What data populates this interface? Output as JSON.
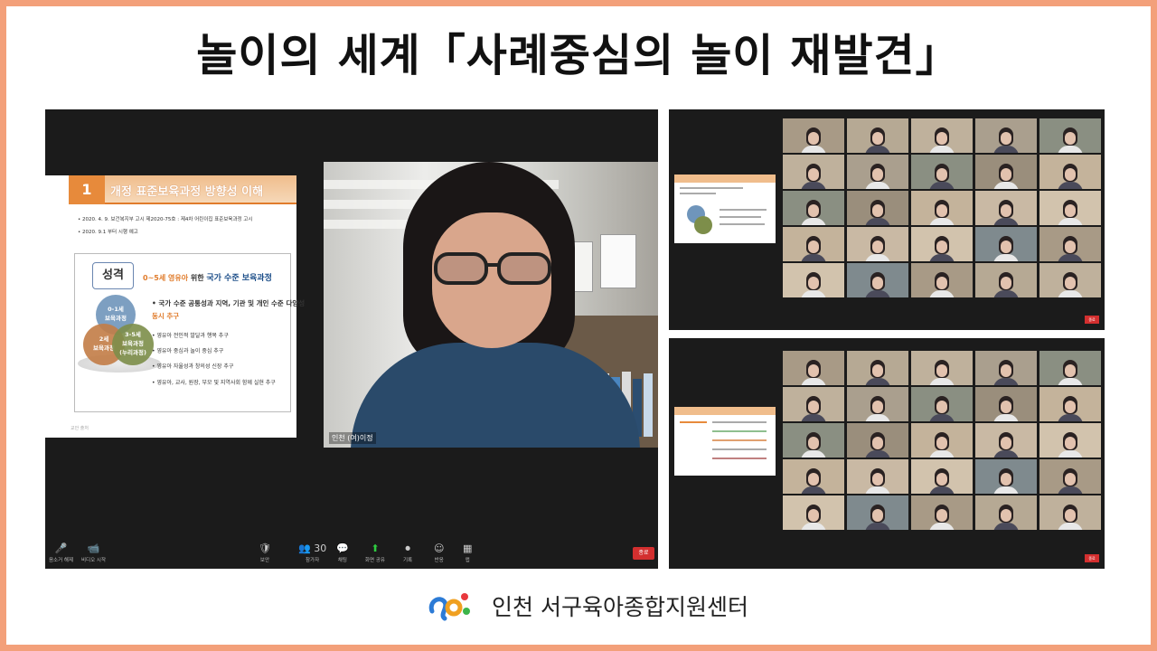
{
  "page": {
    "title": "놀이의 세계「사례중심의 놀이 재발견」",
    "center_name": "인천 서구육아종합지원센터"
  },
  "colors": {
    "frame_border": "#f3a07a",
    "slide_accent": "#e78a3b",
    "zoom_background": "#1b1b1b",
    "end_button": "#d32f2f"
  },
  "slide": {
    "number": "1",
    "title": "개정 표준보육과정 방향성 이해",
    "notes": [
      "• 2020. 4. 9. 보건복지부 고시 제2020-75호 : 제4차 어린이집 표준보육과정 고시",
      "• 2020. 9.1 부터 시행 예고"
    ],
    "character_badge": "성격",
    "character_desc_prefix": "0~5세 영유아",
    "character_desc_mid": " 위한 ",
    "character_desc_emph": "국가 수준 보육과정",
    "venn": [
      "0-1세\n보육과정",
      "2세\n보육과정",
      "3-5세\n보육과정\n(누리과정)"
    ],
    "bullets": [
      {
        "text": "• 국가 수준 공통성과 지역, 기관 및 개인 수준 다양성",
        "style": "big"
      },
      {
        "text": "   동시 추구",
        "style": "big-hl"
      },
      {
        "text": "• 영유아 전인적 발달과 행복 추구",
        "style": "normal"
      },
      {
        "text": "• 영유아 중심과 놀이 중심 추구",
        "style": "normal"
      },
      {
        "text": "• 영유아 자율성과 창의성 신장 추구",
        "style": "normal"
      },
      {
        "text": "• 영유아, 교사, 원장, 부모 및 지역사회 함께 실현 추구",
        "style": "normal"
      }
    ],
    "footer": "교안 출처"
  },
  "speaker": {
    "name": "인천 (여)이정"
  },
  "toolbar": {
    "items": [
      {
        "icon": "mic-off-icon",
        "glyph": "🎤",
        "label": "음소거 해제"
      },
      {
        "icon": "video-off-icon",
        "glyph": "📹",
        "label": "비디오 시작"
      },
      {
        "icon": "security-icon",
        "glyph": "🛡",
        "label": "보안"
      },
      {
        "icon": "participants-icon",
        "glyph": "👥 30",
        "label": "참가자"
      },
      {
        "icon": "chat-icon",
        "glyph": "💬",
        "label": "채팅"
      },
      {
        "icon": "share-screen-icon",
        "glyph": "⬆",
        "label": "화면 공유"
      },
      {
        "icon": "record-icon",
        "glyph": "⏺",
        "label": "기록"
      },
      {
        "icon": "reactions-icon",
        "glyph": "☺",
        "label": "반응"
      },
      {
        "icon": "apps-icon",
        "glyph": "▦",
        "label": "앱"
      }
    ],
    "end_label": "종료"
  }
}
